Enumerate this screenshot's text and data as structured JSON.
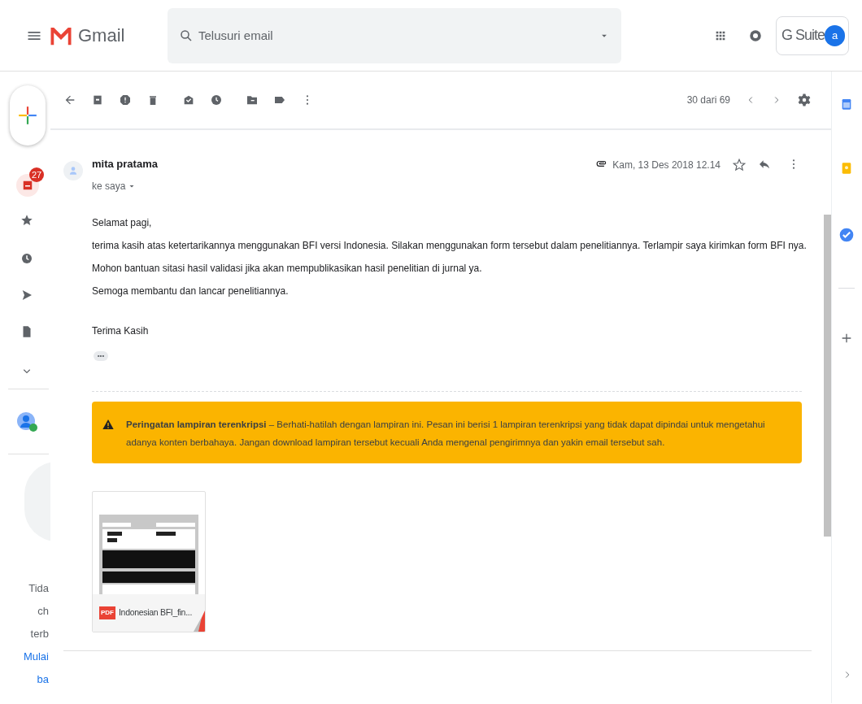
{
  "header": {
    "product": "Gmail",
    "search": {
      "placeholder": "Telusuri email"
    },
    "account": {
      "brand": "G Suite",
      "avatar_letter": "a"
    }
  },
  "toolbar": {
    "count": "30 dari 69"
  },
  "nav": {
    "inbox_badge": "27",
    "promo_lines": [
      "Tida",
      "ch",
      "terb"
    ],
    "promo_link_lines": [
      "Mulai",
      "ba"
    ]
  },
  "message": {
    "sender": "mita pratama",
    "recipient": "ke saya",
    "date": "Kam, 13 Des 2018 12.14",
    "starred": false,
    "body": [
      "Selamat pagi,",
      "terima kasih atas ketertarikannya menggunakan BFI versi Indonesia. Silakan menggunakan form tersebut dalam penelitiannya. Terlampir saya kirimkan form BFI nya.",
      "Mohon bantuan sitasi hasil validasi jika akan mempublikasikan hasil penelitian di jurnal ya.",
      "Semoga membantu dan lancar penelitiannya."
    ],
    "signature": "Terima Kasih",
    "more": "•••",
    "warning": "**Peringatan lampiran terenkripsi** – Berhati-hatilah dengan lampiran ini. Pesan ini berisi 1 lampiran terenkripsi yang tidak dapat dipindai untuk mengetahui adanya konten berbahaya. Jangan download lampiran tersebut kecuali Anda mengenal pengirimnya dan yakin email tersebut sah.",
    "attachments": [
      {
        "name": "Indonesian BFI_fin...",
        "badge": "PDF"
      }
    ]
  }
}
